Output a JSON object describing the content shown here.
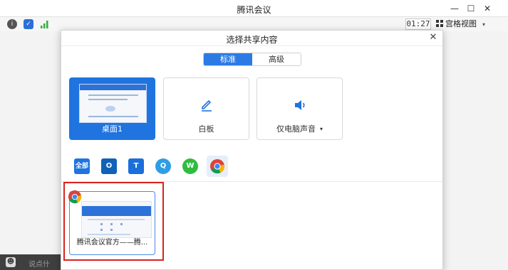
{
  "window": {
    "title": "腾讯会议",
    "minimize": "—",
    "maximize": "☐",
    "close": "✕"
  },
  "toolbar": {
    "timer": "01:27",
    "view_label": "宫格视图",
    "view_caret": "▾"
  },
  "chat": {
    "placeholder": "说点什么..."
  },
  "dialog": {
    "title": "选择共享内容",
    "close": "✕",
    "tabs": [
      {
        "label": "标准",
        "active": true
      },
      {
        "label": "高级",
        "active": false
      }
    ],
    "sources": [
      {
        "label": "桌面1",
        "selected": true
      },
      {
        "label": "白板",
        "selected": false
      },
      {
        "label": "仅电脑声音",
        "selected": false,
        "caret": "▾"
      }
    ],
    "app_filters": [
      {
        "name": "all",
        "text": "全部",
        "color": "#1f74e0"
      },
      {
        "name": "outlook",
        "text": "O",
        "color": "#0f62b8"
      },
      {
        "name": "tencent-docs",
        "text": "T",
        "color": "#1a6fdc"
      },
      {
        "name": "qq-browser",
        "text": "Q",
        "color": "#2e9de6"
      },
      {
        "name": "wechat",
        "text": "W",
        "color": "#2fbc41"
      },
      {
        "name": "chrome",
        "text": "",
        "color": "#ffffff",
        "active": true
      }
    ],
    "windows": [
      {
        "label": "腾讯会议官方——腾..."
      }
    ]
  },
  "colors": {
    "accent": "#1f74e0",
    "highlight": "#d8231f"
  }
}
